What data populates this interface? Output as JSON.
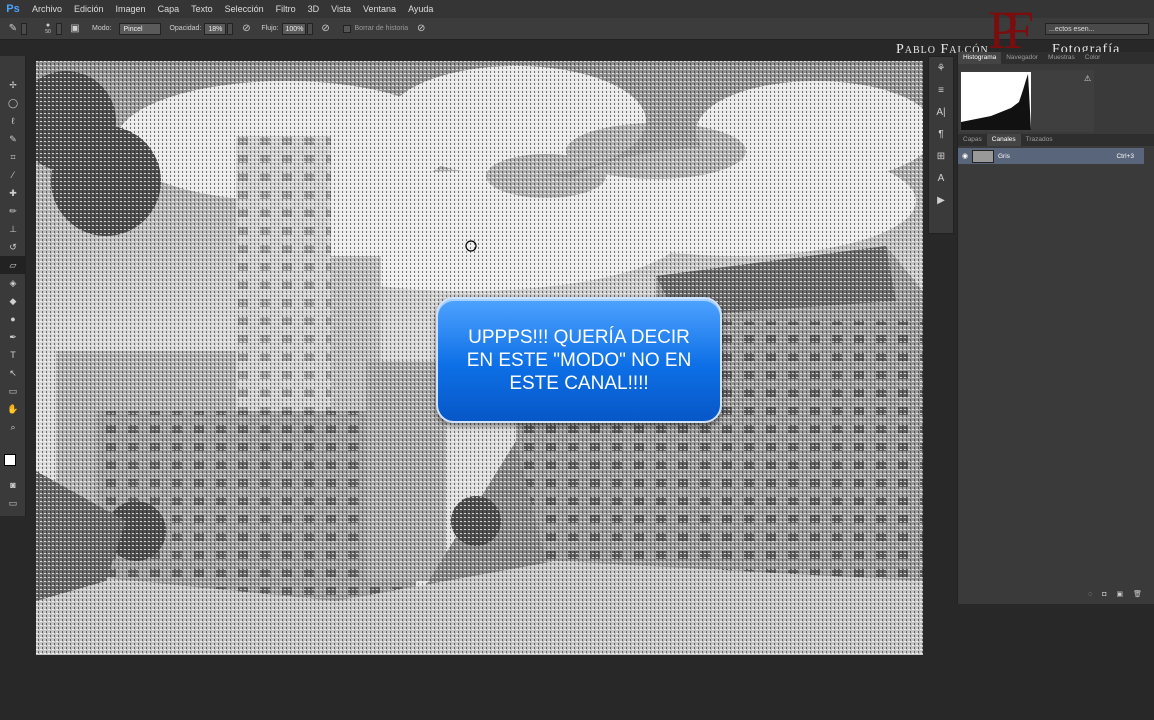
{
  "app": {
    "logo": "Ps"
  },
  "menu": [
    "Archivo",
    "Edición",
    "Imagen",
    "Capa",
    "Texto",
    "Selección",
    "Filtro",
    "3D",
    "Vista",
    "Ventana",
    "Ayuda"
  ],
  "options": {
    "brush_size": "50",
    "mode_label": "Modo:",
    "mode_value": "Pincel",
    "opacity_label": "Opacidad:",
    "opacity_value": "18%",
    "flow_label": "Flujo:",
    "flow_value": "100%",
    "erase_history_label": "Borrar de historia",
    "workspace_value": "...ectos esen..."
  },
  "watermark": {
    "left": "Pablo Falcón",
    "right": "Fotografía",
    "monogram": "PF"
  },
  "panels": {
    "top_tabs": [
      "Histograma",
      "Navegador",
      "Muestras",
      "Color"
    ],
    "warning_icon": "⚠",
    "bottom_tabs": [
      "Capas",
      "Canales",
      "Trazados"
    ],
    "channel": {
      "name": "Gris",
      "shortcut": "Ctrl+3"
    }
  },
  "callout": {
    "text": "UPPPS!!! QUERÍA DECIR\nEN ESTE \"MODO\" NO EN\nESTE CANAL!!!!"
  },
  "colors": {
    "accent": "#0d6fe6",
    "brand_red": "#8b1010"
  }
}
